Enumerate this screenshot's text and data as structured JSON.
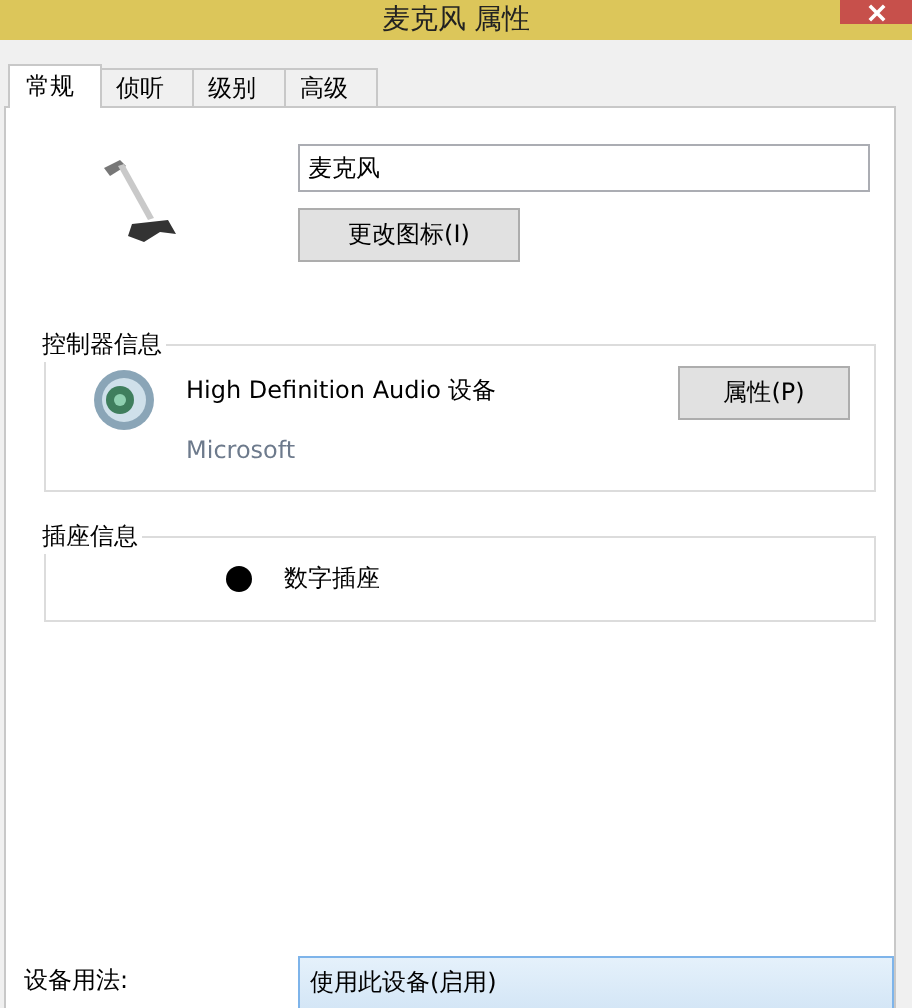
{
  "window": {
    "title": "麦克风 属性"
  },
  "tabs": [
    {
      "label": "常规",
      "selected": true
    },
    {
      "label": "侦听",
      "selected": false
    },
    {
      "label": "级别",
      "selected": false
    },
    {
      "label": "高级",
      "selected": false
    }
  ],
  "device_name": {
    "value": "麦克风"
  },
  "change_icon_button": "更改图标(I)",
  "controller": {
    "legend": "控制器信息",
    "name": "High Definition Audio 设备",
    "vendor": "Microsoft",
    "button": "属性(P)"
  },
  "jack": {
    "legend": "插座信息",
    "color": "#000000",
    "label": "数字插座"
  },
  "usage": {
    "label": "设备用法:",
    "value": "使用此设备(启用)"
  }
}
